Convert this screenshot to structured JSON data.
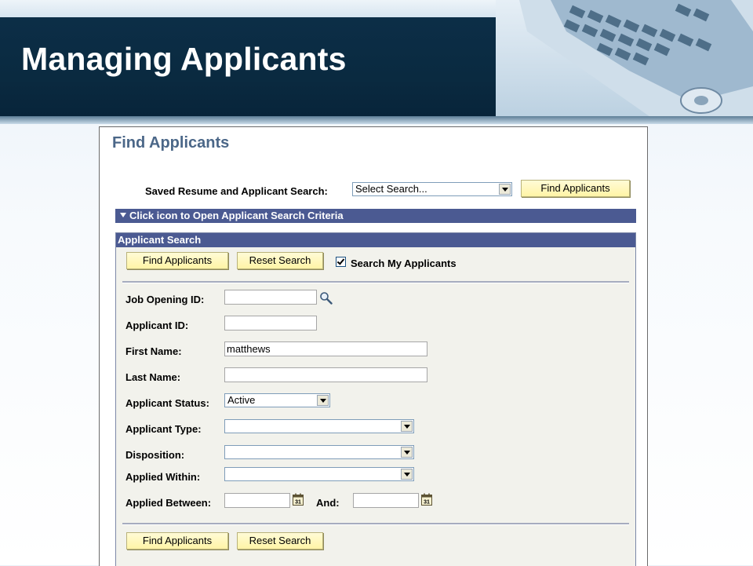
{
  "slide": {
    "title": "Managing Applicants"
  },
  "page": {
    "title": "Find Applicants",
    "saved_search_label": "Saved Resume and Applicant Search:",
    "saved_search_value": "Select Search...",
    "find_button_top": "Find Applicants",
    "criteria_bar": "Click icon to Open Applicant Search Criteria"
  },
  "applicant_search": {
    "header": "Applicant Search",
    "find_button": "Find Applicants",
    "reset_button": "Reset Search",
    "search_my_label": "Search My Applicants",
    "search_my_checked": true,
    "fields": {
      "job_opening_id": {
        "label": "Job Opening ID:",
        "value": ""
      },
      "applicant_id": {
        "label": "Applicant ID:",
        "value": ""
      },
      "first_name": {
        "label": "First Name:",
        "value": "matthews"
      },
      "last_name": {
        "label": "Last Name:",
        "value": ""
      },
      "applicant_status": {
        "label": "Applicant Status:",
        "value": "Active"
      },
      "applicant_type": {
        "label": "Applicant Type:",
        "value": ""
      },
      "disposition": {
        "label": "Disposition:",
        "value": ""
      },
      "applied_within": {
        "label": "Applied Within:",
        "value": ""
      },
      "applied_between": {
        "label": "Applied Between:",
        "from": "",
        "and_label": "And:",
        "to": ""
      }
    },
    "calendar_day": "31",
    "find_button_bottom": "Find Applicants",
    "reset_button_bottom": "Reset Search"
  },
  "colors": {
    "header_band": "#0c2e47",
    "bar": "#4b5a92",
    "button": "#fff4a6",
    "page_title": "#4b6788"
  }
}
